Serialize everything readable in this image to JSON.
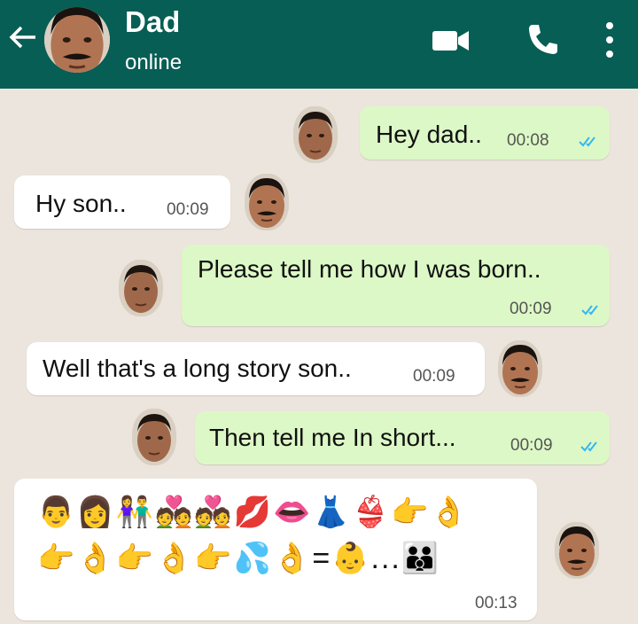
{
  "header": {
    "contact_name": "Dad",
    "status": "online",
    "background_color": "#075e54",
    "icons": [
      "back-arrow-icon",
      "avatar",
      "video-call-icon",
      "voice-call-icon",
      "more-options-icon"
    ]
  },
  "messages": [
    {
      "direction": "outgoing",
      "text": "Hey dad..",
      "time": "00:08",
      "read": true
    },
    {
      "direction": "incoming",
      "text": "Hy son..",
      "time": "00:09"
    },
    {
      "direction": "outgoing",
      "text": "Please tell me how I was born..",
      "time": "00:09",
      "read": true
    },
    {
      "direction": "incoming",
      "text": "Well that's a long story son..",
      "time": "00:09"
    },
    {
      "direction": "outgoing",
      "text": "Then tell me In short...",
      "time": "00:09",
      "read": true
    },
    {
      "direction": "incoming",
      "emoji_line_1": "👨👩👫💑💑💋👄👗👙👉👌",
      "emoji_line_2": "👉👌👉👌👉💦👌=👶...👪",
      "time": "00:13"
    }
  ],
  "colors": {
    "outgoing_bubble": "#dcf8c6",
    "incoming_bubble": "#ffffff",
    "chat_background": "#ece5dd",
    "read_ticks": "#34b7f1"
  }
}
